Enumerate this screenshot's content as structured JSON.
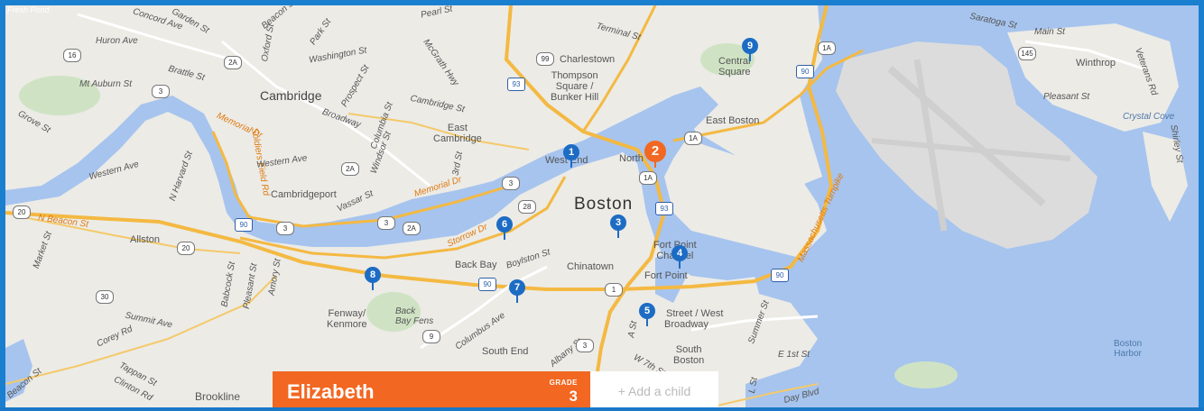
{
  "map": {
    "labels": {
      "fresh_pond": "Fresh Pond",
      "concord_ave": "Concord Ave",
      "garden_st": "Garden St",
      "beacon_st_top": "Beacon St",
      "park_st": "Park St",
      "oxford_st": "Oxford St",
      "pearl_st": "Pearl St",
      "terminal_st": "Terminal St",
      "saratoga_st": "Saratoga St",
      "main_st": "Main St",
      "huron_ave": "Huron Ave",
      "washington_st": "Washington St",
      "mcgrath_hwy": "McGrath Hwy",
      "charlestown": "Charlestown",
      "central_square": "Central\nSquare",
      "winthrop": "Winthrop",
      "veterans_rd": "Veterans Rd",
      "brattle_st": "Brattle St",
      "mt_auburn_st": "Mt Auburn St",
      "cambridge": "Cambridge",
      "prospect_st": "Prospect St",
      "thompson_square": "Thompson\nSquare /\nBunker Hill",
      "cambridge_st": "Cambridge St",
      "broadway": "Broadway",
      "columbia_st": "Columbia St",
      "pleasant_st_winthrop": "Pleasant St",
      "crystal_cove": "Crystal Cove",
      "east_boston": "East Boston",
      "memorial_dr": "Memorial Dr",
      "soldiers_field_rd": "Soldiers Field Rd",
      "grove_st": "Grove St",
      "east_cambridge": "East\nCambridge",
      "windsor_st": "Windsor St",
      "western_ave": "Western Ave",
      "western_ave_2": "Western Ave",
      "harvard_st": "N Harvard St",
      "west_end": "West End",
      "north_end": "North",
      "cambridgeport": "Cambridgeport",
      "vassar_st": "Vassar St",
      "memorial_dr_2": "Memorial Dr",
      "third_st": "3rd St",
      "boston": "Boston",
      "n_beacon_st": "N Beacon St",
      "allston": "Allston",
      "storrow_dr": "Storrow Dr",
      "market_st": "Market St",
      "back_bay": "Back Bay",
      "boylston_st": "Boylston St",
      "chinatown": "Chinatown",
      "fort_point_channel": "Fort Point\nChannel",
      "fort_point": "Fort Point",
      "massachusetts_turnpike": "Massachusetts Turnpike",
      "babcock_st": "Babcock St",
      "pleasant_st": "Pleasant St",
      "amory_st": "Amory St",
      "summit_ave": "Summit Ave",
      "corey_rd": "Corey Rd",
      "fenway_kenmore": "Fenway/\nKenmore",
      "back_bay_fens": "Back\nBay Fens",
      "columbus_ave": "Columbus Ave",
      "broadway_station": "Broadway",
      "street_west": "Street / West",
      "a_st": "A St",
      "summer_st": "Summer St",
      "w_7th_st": "W 7th St",
      "south_boston": "South\nBoston",
      "south_end": "South End",
      "e_1st_st": "E 1st St",
      "l_st": "L St",
      "boston_harbor": "Boston\nHarbor",
      "tappan_st": "Tappan St",
      "clinton_rd": "Clinton Rd",
      "beacon_st_bottom": "Beacon St",
      "brookline": "Brookline",
      "day_blvd": "Day Blvd",
      "albany_st": "Albany St",
      "shirley_st": "Shirley St"
    },
    "shields": [
      "16",
      "2A",
      "3",
      "99",
      "93",
      "1A",
      "145",
      "1A",
      "90",
      "1A",
      "2A",
      "3",
      "28",
      "3",
      "93",
      "20",
      "20",
      "90",
      "3",
      "2A",
      "1",
      "90",
      "90",
      "30",
      "9",
      "3",
      "90"
    ],
    "pins": [
      {
        "num": "1",
        "color": "#1d6cc4"
      },
      {
        "num": "2",
        "color": "#f26722"
      },
      {
        "num": "3",
        "color": "#1d6cc4"
      },
      {
        "num": "4",
        "color": "#1d6cc4"
      },
      {
        "num": "5",
        "color": "#1d6cc4"
      },
      {
        "num": "6",
        "color": "#1d6cc4"
      },
      {
        "num": "7",
        "color": "#1d6cc4"
      },
      {
        "num": "8",
        "color": "#1d6cc4"
      },
      {
        "num": "9",
        "color": "#1d6cc4"
      }
    ]
  },
  "child_bar": {
    "name": "Elizabeth",
    "grade_label": "GRADE",
    "grade_value": "3",
    "add_child_label": "+ Add a child",
    "accent": "#f26722"
  },
  "colors": {
    "frame": "#1b7fd0",
    "water": "#a6c4ee",
    "land": "#ecebe6",
    "highway": "#f4b942"
  }
}
